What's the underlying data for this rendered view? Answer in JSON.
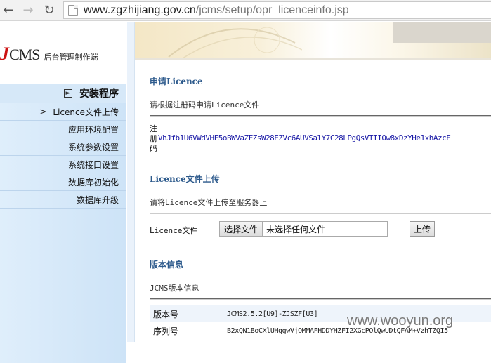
{
  "browser": {
    "url_host": "www.zgzhijiang.gov.cn",
    "url_path": "/jcms/setup/opr_licenceinfo.jsp"
  },
  "logo": {
    "brand_j": "J",
    "brand_cms": "CMS",
    "subtitle": "后台管理制作端"
  },
  "menu": {
    "heading": "安装程序",
    "active_marker": "->",
    "items": [
      {
        "label": "Licence文件上传"
      },
      {
        "label": "应用环境配置"
      },
      {
        "label": "系统参数设置"
      },
      {
        "label": "系统接口设置"
      },
      {
        "label": "数据库初始化"
      },
      {
        "label": "数据库升级"
      }
    ]
  },
  "apply": {
    "title": "申请Licence",
    "desc": "请根据注册码申请Licence文件",
    "reg_label_1": "注",
    "reg_label_2": "册",
    "reg_label_3": "码",
    "reg_code": "VhJfb1U6VWdVHF5oBWVaZFZsW28EZVc6AUVSalY7C28LPgQsVTIIOw8xDzYHe1xhAzcE"
  },
  "upload": {
    "title": "Licence文件上传",
    "desc": "请将Licence文件上传至服务器上",
    "field_label": "Licence文件",
    "choose_button": "选择文件",
    "file_status": "未选择任何文件",
    "upload_button": "上传"
  },
  "version": {
    "title": "版本信息",
    "desc": "JCMS版本信息",
    "rows": [
      {
        "key": "版本号",
        "value": "JCMS2.5.2[U9]-ZJSZF[U3]"
      },
      {
        "key": "序列号",
        "value": "B2xQN1BoCXlUHggwVjOMMAFHDDYHZFI2XGcPOlQwUDtQFAM+VzhTZQI5"
      }
    ]
  },
  "watermark": "www.wooyun.org"
}
